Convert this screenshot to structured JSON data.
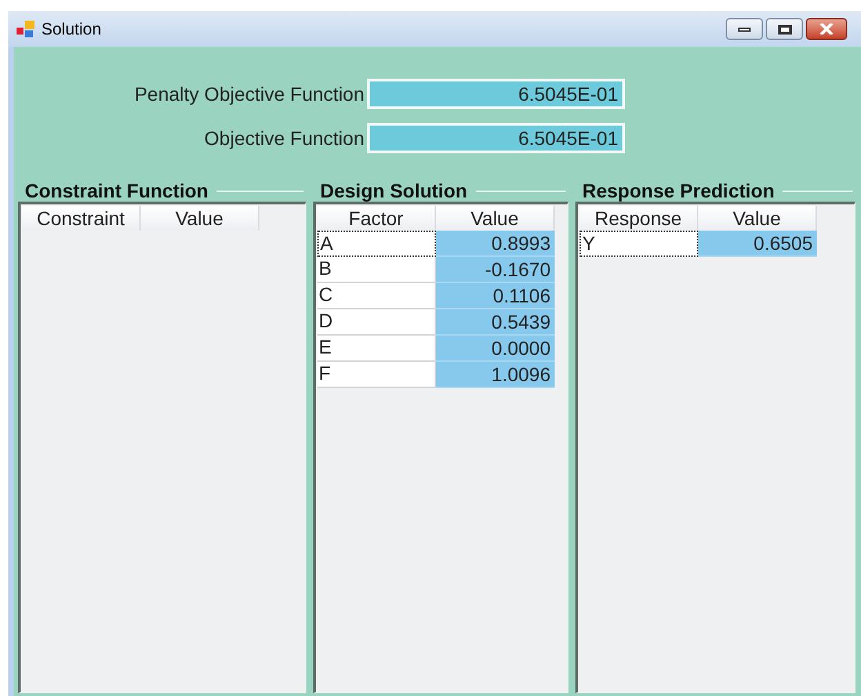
{
  "window": {
    "title": "Solution"
  },
  "summary": [
    {
      "label": "Penalty Objective Function",
      "value": "6.5045E-01"
    },
    {
      "label": "Objective Function",
      "value": "6.5045E-01"
    }
  ],
  "groups": [
    {
      "title": "Constraint Function",
      "columns": [
        "Constraint",
        "Value"
      ]
    },
    {
      "title": "Design Solution",
      "columns": [
        "Factor",
        "Value"
      ],
      "rows": [
        {
          "name": "A",
          "value": "0.8993",
          "focused": true
        },
        {
          "name": "B",
          "value": "-0.1670",
          "focused": false
        },
        {
          "name": "C",
          "value": "0.1106",
          "focused": false
        },
        {
          "name": "D",
          "value": "0.5439",
          "focused": false
        },
        {
          "name": "E",
          "value": "0.0000",
          "focused": false
        },
        {
          "name": "F",
          "value": "1.0096",
          "focused": false
        }
      ]
    },
    {
      "title": "Response Prediction",
      "columns": [
        "Response",
        "Value"
      ],
      "rows": [
        {
          "name": "Y",
          "value": "0.6505",
          "focused": true
        }
      ]
    }
  ]
}
